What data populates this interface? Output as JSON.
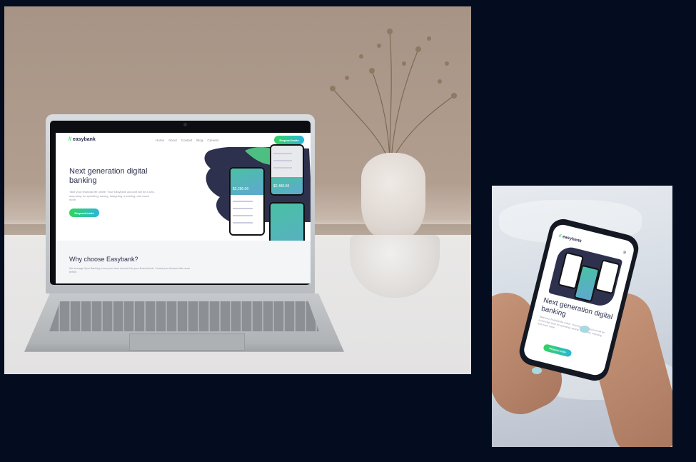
{
  "desktop_mockup": {
    "site": {
      "logo": "easybank",
      "nav": [
        "Home",
        "About",
        "Contact",
        "Blog",
        "Careers"
      ],
      "cta": "Request Invite",
      "hero": {
        "title": "Next generation digital banking",
        "text": "Take your financial life online. Your Easybank account will be a one-stop-shop for spending, saving, budgeting, investing, and much more.",
        "cta": "Request Invite",
        "phone_amounts": [
          "$2,280.00",
          "$2,480.00"
        ]
      },
      "why": {
        "title": "Why choose Easybank?",
        "text": "We leverage Open Banking to turn your bank account into your financial hub. Control your finances like never before."
      }
    }
  },
  "mobile_mockup": {
    "site": {
      "logo": "easybank",
      "hero_title": "Next generation digital banking",
      "hero_text": "Take your financial life online. Your Easybank account will be a one-stop-shop for spending, saving, budgeting, investing, and much more.",
      "cta": "Request Invite"
    }
  },
  "colors": {
    "page_background": "#030d1f",
    "brand_dark": "#2d314d",
    "brand_green": "#31d35c",
    "brand_cyan": "#2ab6d9"
  }
}
